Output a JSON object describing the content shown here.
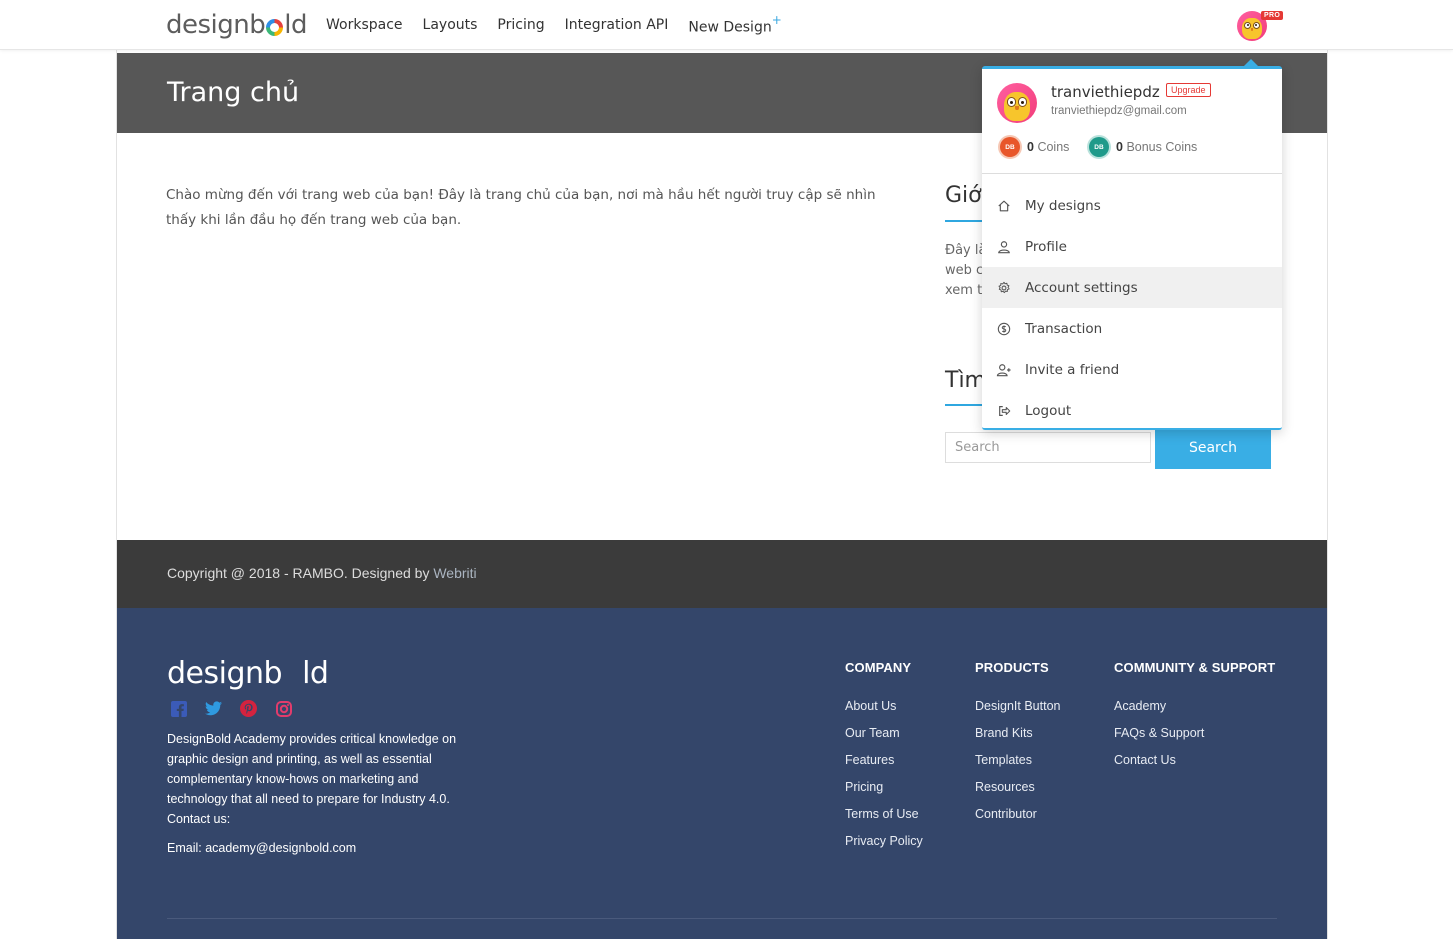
{
  "topnav": {
    "logo_text_1": "design",
    "logo_text_2": "b",
    "logo_text_3": "ld",
    "links": [
      "Workspace",
      "Layouts",
      "Pricing",
      "Integration API",
      "New Design"
    ],
    "new_design_plus": "+",
    "pro_badge": "PRO"
  },
  "hero": {
    "title": "Trang chủ"
  },
  "main": {
    "intro": "Chào mừng đến với trang web của bạn! Đây là trang chủ của bạn, nơi mà hầu hết người truy cập sẽ nhìn thấy khi lần đầu họ đến trang web của bạn."
  },
  "sidebar": {
    "about_title": "Giới",
    "about_lines": [
      "Đây là",
      "web c",
      "xem t"
    ],
    "search_title": "Tìm",
    "search_placeholder": "Search",
    "search_button": "Search"
  },
  "dropdown": {
    "username": "tranviethiepdz",
    "upgrade": "Upgrade",
    "email": "tranviethiepdz@gmail.com",
    "coins_value": "0",
    "coins_label": "Coins",
    "bonus_value": "0",
    "bonus_label": "Bonus Coins",
    "coin_badge": "DB",
    "items": [
      {
        "label": "My designs",
        "icon": "home-icon"
      },
      {
        "label": "Profile",
        "icon": "user-icon"
      },
      {
        "label": "Account settings",
        "icon": "gear-icon"
      },
      {
        "label": "Transaction",
        "icon": "dollar-icon"
      },
      {
        "label": "Invite a friend",
        "icon": "user-plus-icon"
      },
      {
        "label": "Logout",
        "icon": "logout-icon"
      }
    ]
  },
  "copyright": {
    "text": "Copyright @ 2018 - RAMBO. Designed by",
    "link": "Webriti"
  },
  "footer": {
    "about": "DesignBold Academy provides critical knowledge on graphic design and printing, as well as essential complementary know-hows on marketing and technology that all need to prepare for Industry 4.0.",
    "contact": "Contact us:",
    "email": "Email: academy@designbold.com",
    "columns": [
      {
        "title": "COMPANY",
        "links": [
          "About Us",
          "Our Team",
          "Features",
          "Pricing",
          "Terms of Use",
          "Privacy Policy"
        ]
      },
      {
        "title": "PRODUCTS",
        "links": [
          "DesignIt Button",
          "Brand Kits",
          "Templates",
          "Resources",
          "Contributor"
        ]
      },
      {
        "title": "COMMUNITY & SUPPORT",
        "links": [
          "Academy",
          "FAQs & Support",
          "Contact Us"
        ]
      }
    ]
  },
  "colors": {
    "accent": "#39aee5",
    "hero_bg": "#575757",
    "footer_bg": "#34466a",
    "copyright_bg": "#3b3b3b",
    "pro": "#e53935"
  }
}
